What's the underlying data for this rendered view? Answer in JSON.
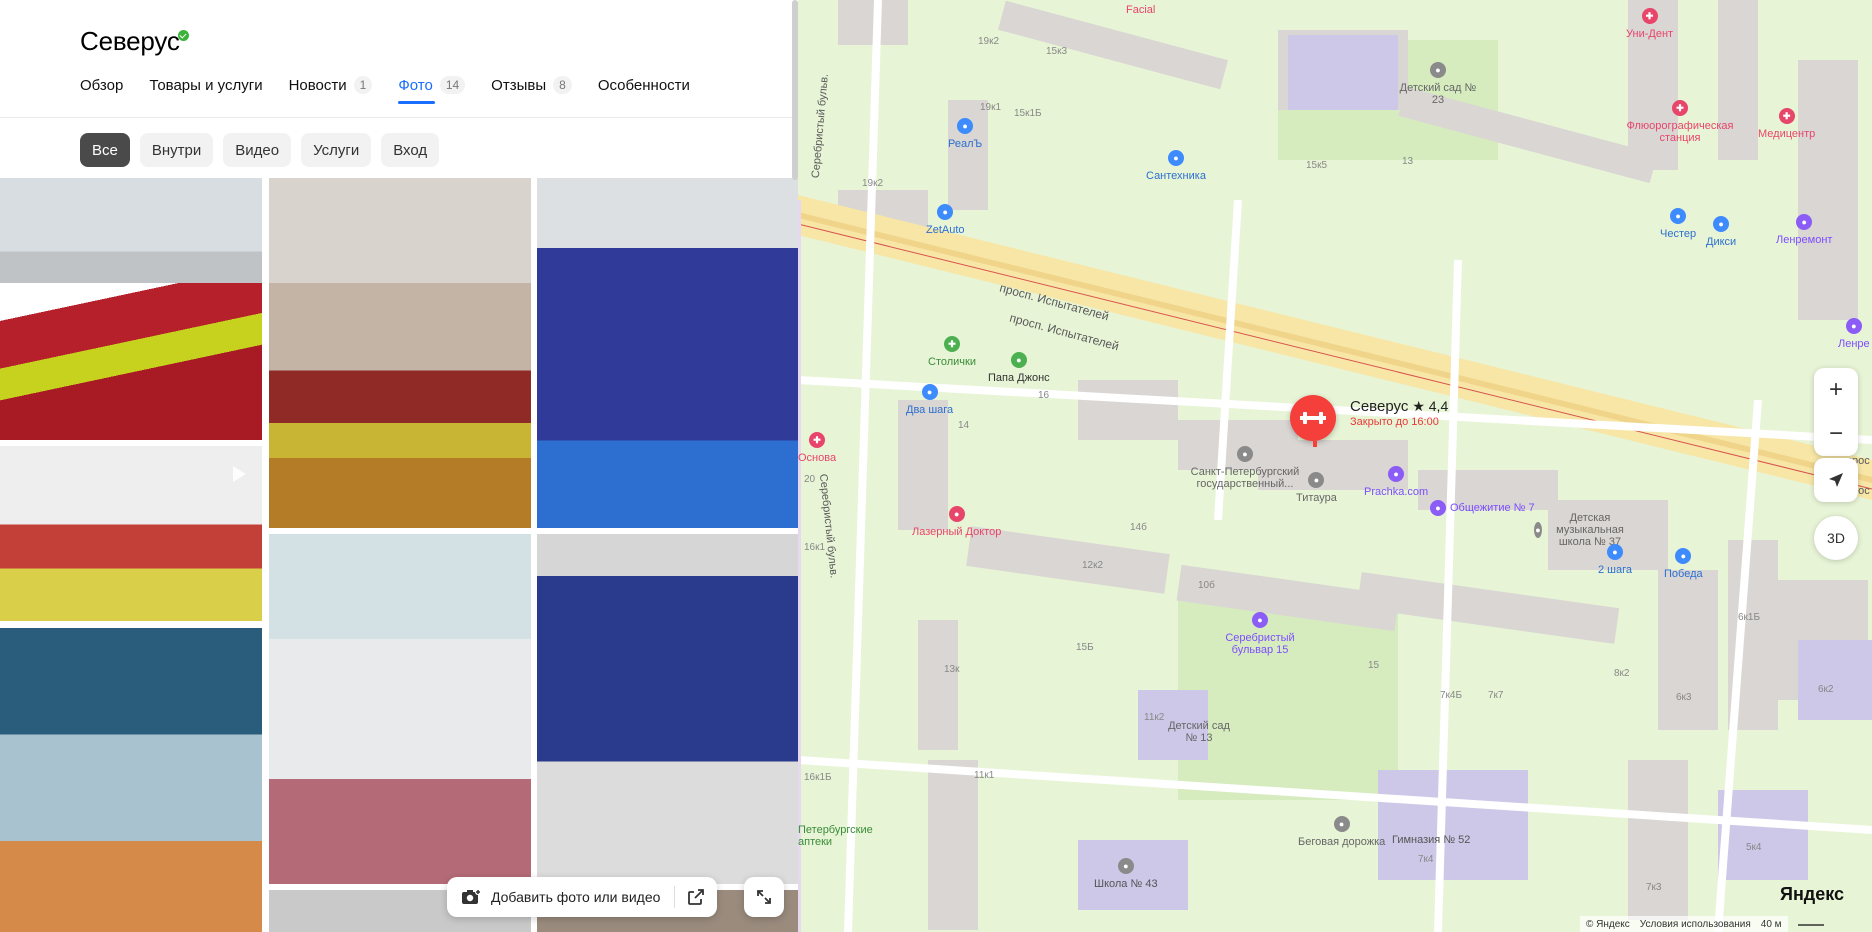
{
  "org": {
    "name": "Северус"
  },
  "tabs": [
    {
      "label": "Обзор",
      "count": ""
    },
    {
      "label": "Товары и услуги",
      "count": ""
    },
    {
      "label": "Новости",
      "count": "1"
    },
    {
      "label": "Фото",
      "count": "14"
    },
    {
      "label": "Отзывы",
      "count": "8"
    },
    {
      "label": "Особенности",
      "count": ""
    }
  ],
  "filters": [
    "Все",
    "Внутри",
    "Видео",
    "Услуги",
    "Вход"
  ],
  "actions": {
    "add_media": "Добавить фото или видео"
  },
  "map": {
    "streets": [
      "просп. Испытателей",
      "просп. Испытателей",
      "Серебристый бульв.",
      "Серебристый бульв.",
      "прос",
      "прос"
    ],
    "pin": {
      "name": "Северус",
      "rating": "★ 4,4",
      "status": "Закрыто до 16:00"
    },
    "pois": [
      {
        "name": "Facial",
        "color": "#e8456b"
      },
      {
        "name": "Уни-Дент",
        "color": "#e8456b"
      },
      {
        "name": "Детский сад № 23",
        "color": "#8a8a8a"
      },
      {
        "name": "Флюорографическая станция",
        "color": "#e8456b"
      },
      {
        "name": "Медицентр",
        "color": "#e8456b"
      },
      {
        "name": "РеалЪ",
        "color": "#3d8bfd"
      },
      {
        "name": "Сантехника",
        "color": "#3d8bfd"
      },
      {
        "name": "ZetAuto",
        "color": "#3d8bfd"
      },
      {
        "name": "Честер",
        "color": "#3d8bfd"
      },
      {
        "name": "Дикси",
        "color": "#3d8bfd"
      },
      {
        "name": "Ленремонт",
        "color": "#8b5cf6"
      },
      {
        "name": "Столички",
        "color": "#4caf50"
      },
      {
        "name": "Папа Джонс",
        "color": "#4caf50"
      },
      {
        "name": "Два шага",
        "color": "#3d8bfd"
      },
      {
        "name": "Основа",
        "color": "#e8456b"
      },
      {
        "name": "Санкт-Петербургский государственный...",
        "color": "#8a8a8a"
      },
      {
        "name": "Титаура",
        "color": "#8a8a8a"
      },
      {
        "name": "Prachka.com",
        "color": "#8b5cf6"
      },
      {
        "name": "Общежитие № 7",
        "color": "#8b5cf6"
      },
      {
        "name": "Детская музыкальная школа № 37",
        "color": "#8a8a8a"
      },
      {
        "name": "2 шага",
        "color": "#3d8bfd"
      },
      {
        "name": "Победа",
        "color": "#3d8bfd"
      },
      {
        "name": "Лазерный Доктор",
        "color": "#e8456b"
      },
      {
        "name": "Серебристый бульвар 15",
        "color": "#8b5cf6"
      },
      {
        "name": "Детский сад № 13",
        "color": "#8a8a8a"
      },
      {
        "name": "Беговая дорожка",
        "color": "#8a8a8a"
      },
      {
        "name": "Гимназия № 52",
        "color": "#8a8a8a"
      },
      {
        "name": "Школа № 43",
        "color": "#8a8a8a"
      },
      {
        "name": "Петербургские аптеки",
        "color": "#4caf50"
      },
      {
        "name": "Ленре",
        "color": "#8b5cf6"
      }
    ],
    "buildings": [
      "19к2",
      "15к3",
      "19к1",
      "15к1Б",
      "15к5",
      "13",
      "19к2",
      "16",
      "14",
      "14б",
      "12к2",
      "10б",
      "15Б",
      "13к",
      "11к2",
      "15",
      "7к4Б",
      "7к7",
      "8к2",
      "6к3",
      "6к1Б",
      "6к2",
      "11к1",
      "7к4",
      "7к3",
      "5к4",
      "16к1",
      "16к1Б",
      "20"
    ],
    "logo": "Яндекс",
    "copyright": "© Яндекс",
    "terms": "Условия использования",
    "scale": "40 м",
    "ctl_3d": "3D"
  }
}
